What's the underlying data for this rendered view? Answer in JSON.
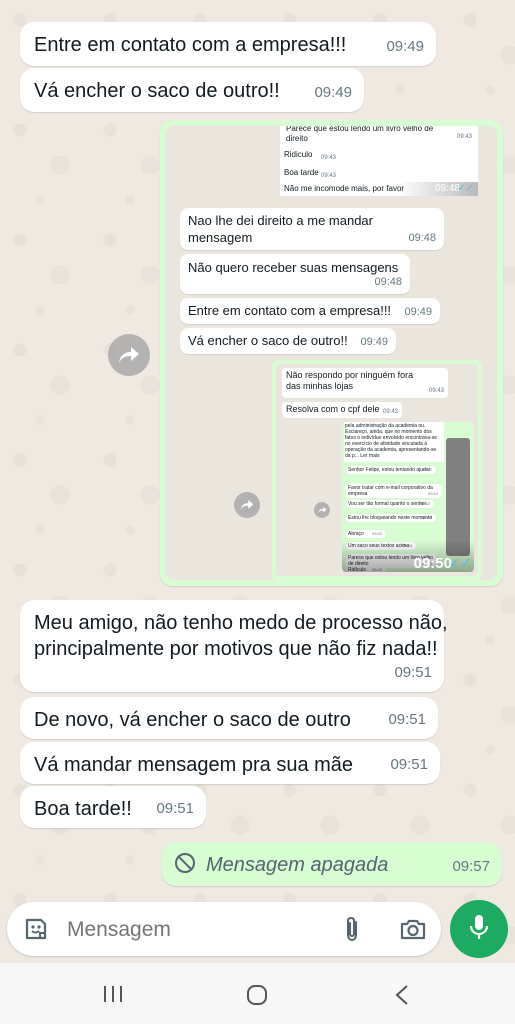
{
  "messages": [
    {
      "text": "Entre em contato com a empresa!!!",
      "time": "09:49"
    },
    {
      "text": "Vá encher o saco de outro!!",
      "time": "09:49"
    },
    {
      "text": "Meu amigo, não tenho medo de processo não, principalmente por motivos que não fiz nada!!",
      "time": "09:51"
    },
    {
      "text": "De novo, vá encher o saco de outro",
      "time": "09:51"
    },
    {
      "text": "Vá mandar mensagem pra sua mãe",
      "time": "09:51"
    },
    {
      "text": "Boa tarde!!",
      "time": "09:51"
    }
  ],
  "deleted": {
    "text": "Mensagem apagada",
    "time": "09:57"
  },
  "screenshot1": {
    "top_fragments": [
      {
        "text": "Parece que estou lendo um livro velho de direito",
        "time": "09:43"
      },
      {
        "text": "Ridiculo",
        "time": "09:43"
      },
      {
        "text": "Boa tarde",
        "time": "09:43"
      },
      {
        "text": "Não me incomode mais, por favor",
        "time": "09:48"
      }
    ],
    "messages": [
      {
        "text": "Nao lhe dei direito a me mandar mensagem",
        "time": "09:48"
      },
      {
        "text": "Não quero receber suas mensagens",
        "time": "09:48"
      },
      {
        "text": "Entre em contato com a empresa!!!",
        "time": "09:49"
      },
      {
        "text": "Vá encher o saco de outro!!",
        "time": "09:49"
      }
    ],
    "nested": {
      "messages": [
        {
          "text": "Não respondo por ninguém fora das minhas lojas",
          "time": "09:43"
        },
        {
          "text": "Resolva com o cpf dele",
          "time": "09:43"
        }
      ],
      "footer_time": "09:50",
      "tiny_messages": [
        {
          "text": "Senhor Felipe, estou tentando ajudar",
          "time": "09:42"
        },
        {
          "text": "Favor tratar com e-mail corporativo da empresa",
          "time": "09:42"
        },
        {
          "text": "Vou ser tão formal quanto o senhor",
          "time": "09:42"
        },
        {
          "text": "Estou lhe bloqueando neste momento",
          "time": "09:42"
        },
        {
          "text": "Abraço",
          "time": "09:42"
        },
        {
          "text": "Um saco seus textos acima",
          "time": "09:43"
        },
        {
          "text": "Parece que estou lendo um livro velho de direito",
          "time": "09:43"
        },
        {
          "text": "Ridículo",
          "time": "09:43"
        }
      ],
      "tiny_top_text": "pela administração da academia ou. Esclareço, ainda, que no momento dos fatos o indivíduo envolvido encontrava-se no exercício de atividade vinculada à operação da academia, apresentando-se da p... Ler mais"
    }
  },
  "input": {
    "placeholder": "Mensagem"
  },
  "colors": {
    "outgoing": "#d9fdd3",
    "incoming": "#ffffff",
    "accent": "#1daa61",
    "ticks": "#53bdeb"
  }
}
